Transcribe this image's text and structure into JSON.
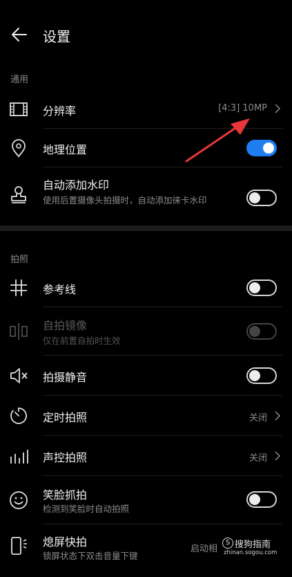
{
  "header": {
    "title": "设置"
  },
  "sections": {
    "general": "通用",
    "photo": "拍照"
  },
  "rows": {
    "resolution": {
      "title": "分辨率",
      "value": "[4:3] 10MP"
    },
    "location": {
      "title": "地理位置",
      "state": "on"
    },
    "watermark": {
      "title": "自动添加水印",
      "sub": "使用后置摄像头拍摄时，自动添加徕卡水印",
      "state": "off"
    },
    "grid": {
      "title": "参考线",
      "state": "off"
    },
    "mirror": {
      "title": "自拍镜像",
      "sub": "仅在前置自拍时生效",
      "state": "disabled"
    },
    "mute": {
      "title": "拍摄静音",
      "state": "off"
    },
    "timer": {
      "title": "定时拍照",
      "value": "关闭"
    },
    "voice": {
      "title": "声控拍照",
      "value": "关闭"
    },
    "smile": {
      "title": "笑脸抓拍",
      "sub": "检测到笑脸时自动拍照",
      "state": "off"
    },
    "snapshot": {
      "title": "熄屏快拍",
      "sub": "锁屏状态下双击音量下键",
      "value": "启动相"
    }
  },
  "watermark_brand": {
    "main": "搜狗指南",
    "sub": "zhinan.sogou.com",
    "logo": "S"
  },
  "colors": {
    "accent": "#1f7ef0",
    "arrow": "#e8373a",
    "background": "#000000"
  }
}
